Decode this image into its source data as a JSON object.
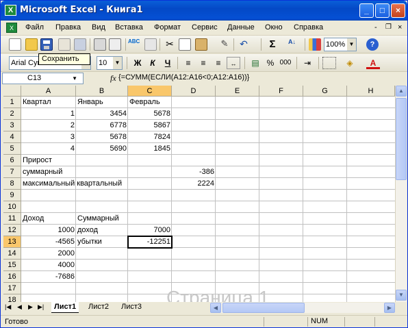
{
  "window": {
    "title": "Microsoft Excel - Книга1",
    "icon_letter": "X"
  },
  "title_buttons": {
    "minimize": "_",
    "maximize": "□",
    "close": "×"
  },
  "menu": [
    "Файл",
    "Правка",
    "Вид",
    "Вставка",
    "Формат",
    "Сервис",
    "Данные",
    "Окно",
    "Справка"
  ],
  "menu_right": {
    "help_placeholder": "",
    "min": "-",
    "restore": "ₐ",
    "close": "×"
  },
  "toolbar": {
    "zoom": "100%",
    "tooltip": "Сохранить"
  },
  "format_toolbar": {
    "font": "Arial Cyr",
    "size": "10",
    "bold": "Ж",
    "italic": "К",
    "underline": "Ч",
    "percent": "%",
    "thousands": "000"
  },
  "formula_bar": {
    "name_box": "C13",
    "fx": "fx",
    "formula": "{=СУММ(ЕСЛИ(A12:A16<0;A12:A16))}"
  },
  "columns": [
    "A",
    "B",
    "C",
    "D",
    "E",
    "F",
    "G",
    "H"
  ],
  "rows": [
    "1",
    "2",
    "3",
    "4",
    "5",
    "6",
    "7",
    "8",
    "9",
    "10",
    "11",
    "12",
    "13",
    "14",
    "15",
    "16",
    "17",
    "18"
  ],
  "cells": {
    "A1": "Квартал",
    "B1": "Январь",
    "C1": "Февраль",
    "A2": "1",
    "B2": "3454",
    "C2": "5678",
    "A3": "2",
    "B3": "6778",
    "C3": "5867",
    "A4": "3",
    "B4": "5678",
    "C4": "7824",
    "A5": "4",
    "B5": "5690",
    "C5": "1845",
    "A6": "Прирост",
    "A7": "суммарный",
    "D7": "-386",
    "A8": "максимальный квартальный",
    "D8": "2224",
    "A11": "Доход",
    "B11": "Суммарный",
    "A12": "1000",
    "B12": "доход",
    "C12": "7000",
    "A13": "-4565",
    "B13": "убытки",
    "C13": "-12251",
    "A14": "2000",
    "A15": "4000",
    "A16": "-7686"
  },
  "watermark": "Страница 1",
  "sheet_tabs": [
    "Лист1",
    "Лист2",
    "Лист3"
  ],
  "status": {
    "text": "Готово",
    "num": "NUM"
  }
}
